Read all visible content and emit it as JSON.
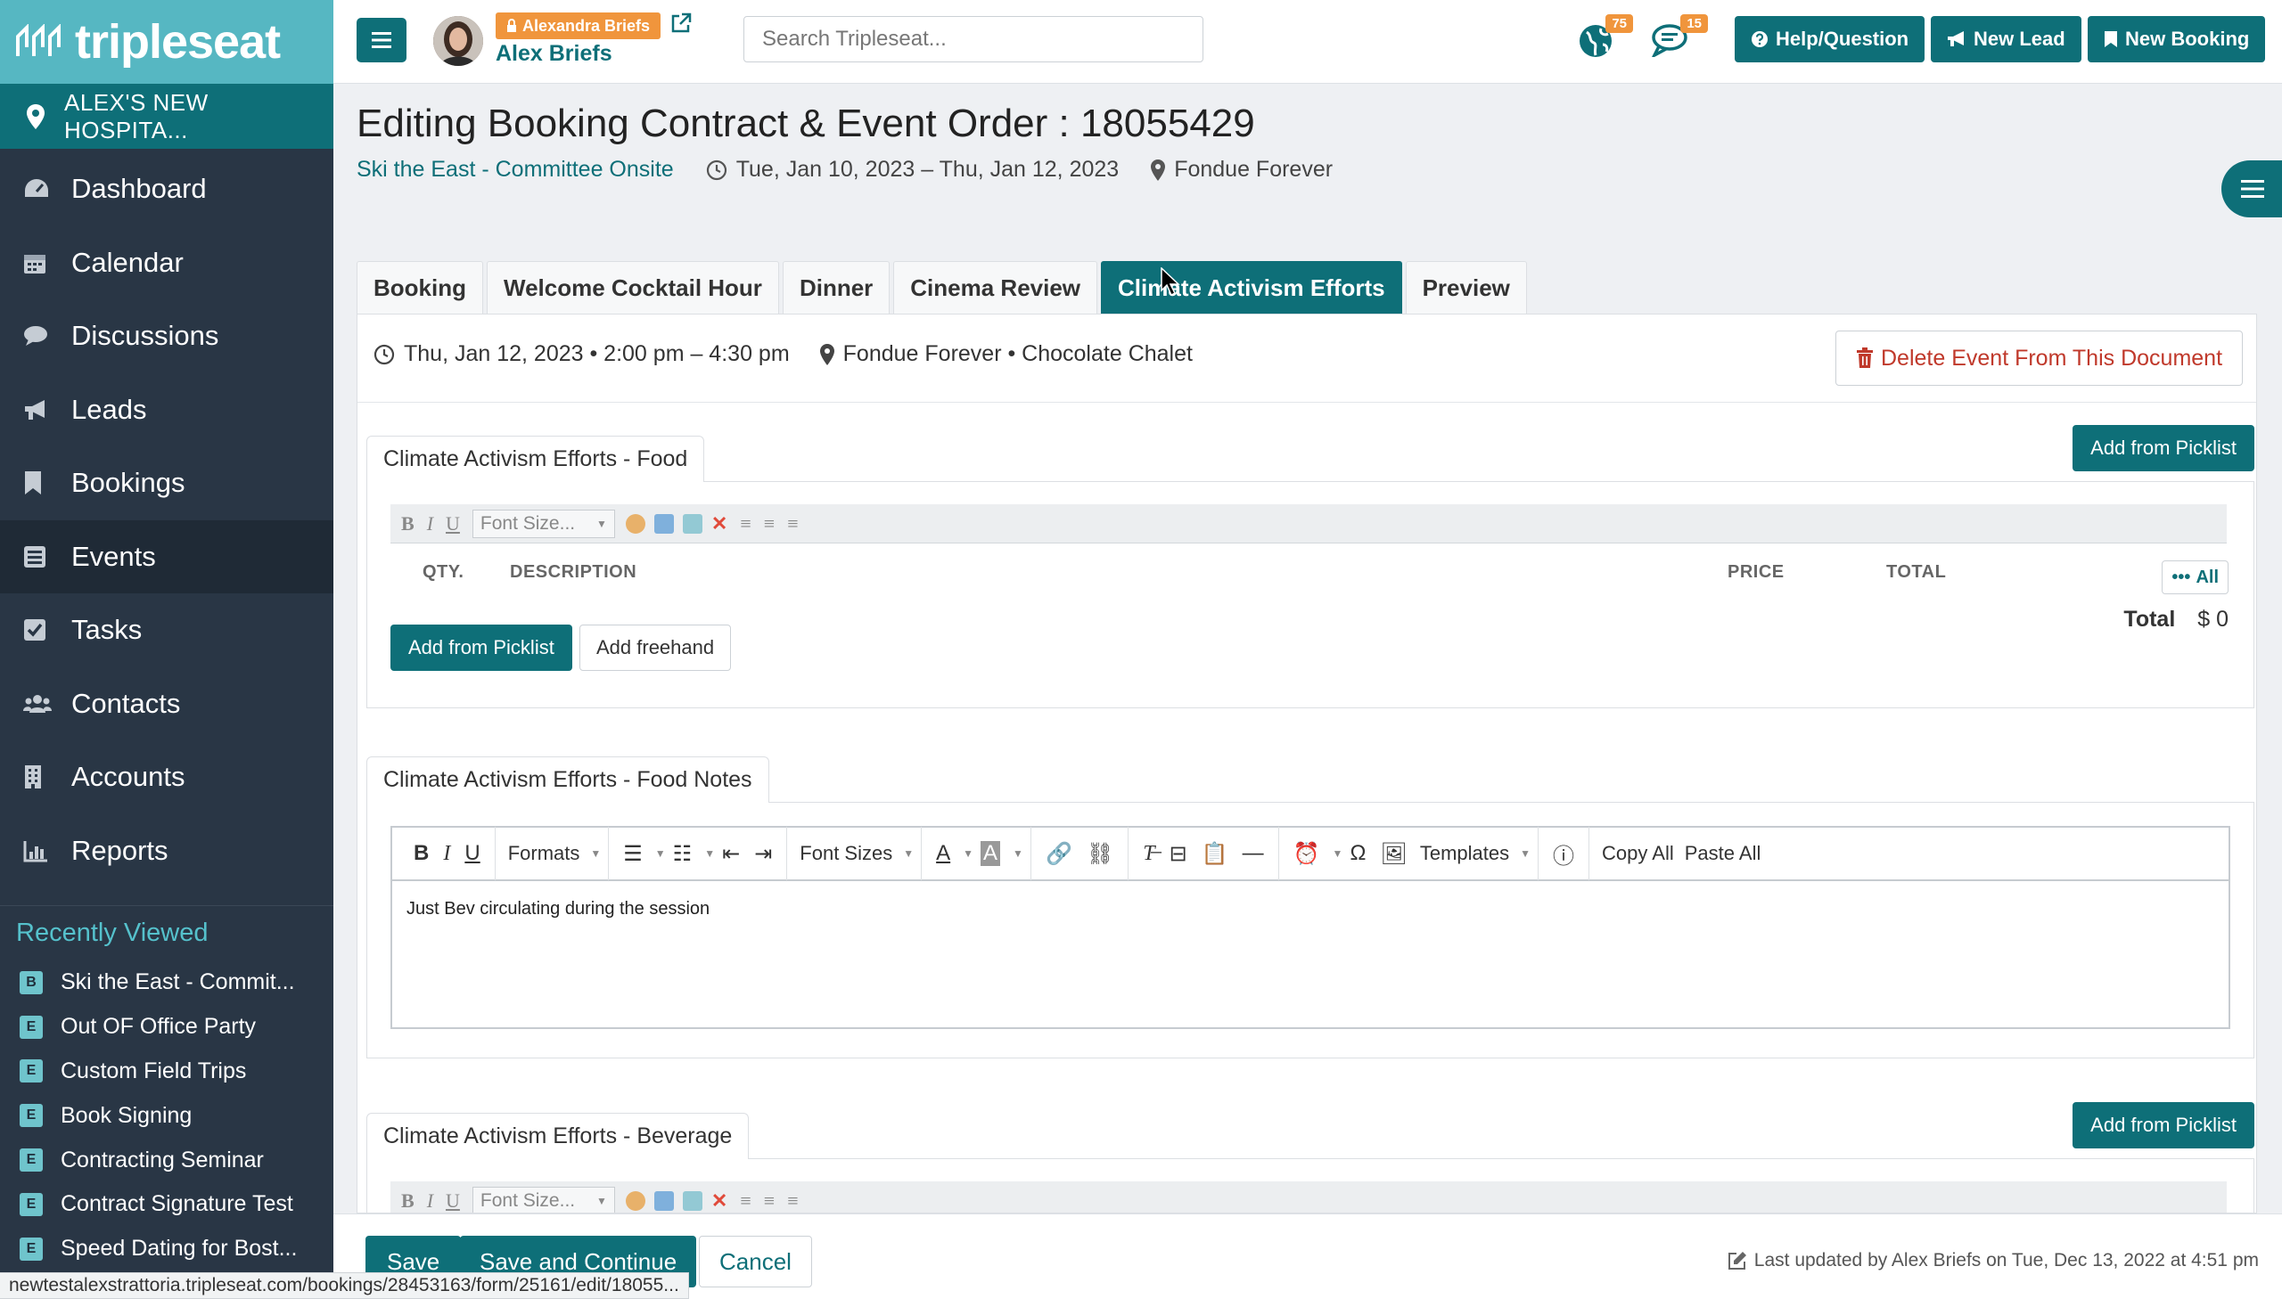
{
  "brand": {
    "name": "tripleseat",
    "accent": "#0e6f78",
    "logo_bg": "#56b7c2",
    "sidebar_bg": "#293645",
    "badge_color": "#f0953c"
  },
  "sidebar": {
    "venue": "ALEX'S NEW HOSPITA...",
    "nav": [
      {
        "label": "Dashboard",
        "icon": "dashboard-icon"
      },
      {
        "label": "Calendar",
        "icon": "calendar-icon"
      },
      {
        "label": "Discussions",
        "icon": "comment-icon"
      },
      {
        "label": "Leads",
        "icon": "megaphone-icon"
      },
      {
        "label": "Bookings",
        "icon": "bookmark-icon"
      },
      {
        "label": "Events",
        "icon": "list-icon"
      },
      {
        "label": "Tasks",
        "icon": "checkbox-icon"
      },
      {
        "label": "Contacts",
        "icon": "users-icon"
      },
      {
        "label": "Accounts",
        "icon": "building-icon"
      },
      {
        "label": "Reports",
        "icon": "bar-chart-icon"
      }
    ],
    "recent_title": "Recently Viewed",
    "recent": [
      {
        "badge": "B",
        "label": "Ski the East - Commit..."
      },
      {
        "badge": "E",
        "label": "Out OF Office Party"
      },
      {
        "badge": "E",
        "label": "Custom Field Trips"
      },
      {
        "badge": "E",
        "label": "Book Signing"
      },
      {
        "badge": "E",
        "label": "Contracting Seminar"
      },
      {
        "badge": "E",
        "label": "Contract Signature Test"
      },
      {
        "badge": "E",
        "label": "Speed Dating for Bost..."
      }
    ]
  },
  "topbar": {
    "impersonating": "Alexandra Briefs",
    "user_name": "Alex Briefs",
    "search_placeholder": "Search Tripleseat...",
    "notifications": {
      "globe": "75",
      "chat": "15"
    },
    "help_label": "Help/Question",
    "new_lead_label": "New Lead",
    "new_booking_label": "New Booking"
  },
  "header": {
    "title": "Editing Booking Contract & Event Order : 18055429",
    "booking_name": "Ski the East - Committee Onsite",
    "date_range": "Tue, Jan 10, 2023 – Thu, Jan 12, 2023",
    "location": "Fondue Forever"
  },
  "tabs": [
    {
      "label": "Booking",
      "active": false
    },
    {
      "label": "Welcome Cocktail Hour",
      "active": false
    },
    {
      "label": "Dinner",
      "active": false
    },
    {
      "label": "Cinema Review",
      "active": false
    },
    {
      "label": "Climate Activism Efforts",
      "active": true
    },
    {
      "label": "Preview",
      "active": false
    }
  ],
  "event": {
    "datetime": "Thu, Jan 12, 2023 • 2:00 pm – 4:30 pm",
    "location": "Fondue Forever • Chocolate Chalet",
    "delete_label": "Delete Event From This Document"
  },
  "sections": {
    "food": {
      "title": "Climate Activism Efforts - Food",
      "picklist_label": "Add from Picklist",
      "font_size_placeholder": "Font Size...",
      "columns": {
        "qty": "QTY.",
        "description": "DESCRIPTION",
        "price": "PRICE",
        "total": "TOTAL"
      },
      "all_label": "All",
      "total_label": "Total",
      "total_value": "$ 0",
      "add_picklist_label": "Add from Picklist",
      "add_freehand_label": "Add freehand"
    },
    "food_notes": {
      "title": "Climate Activism Efforts - Food Notes",
      "toolbar": {
        "formats": "Formats",
        "font_sizes": "Font Sizes",
        "templates": "Templates",
        "copy_all": "Copy All",
        "paste_all": "Paste All"
      },
      "body": "Just Bev circulating during the session"
    },
    "beverage": {
      "title": "Climate Activism Efforts - Beverage",
      "picklist_label": "Add from Picklist",
      "font_size_placeholder": "Font Size..."
    }
  },
  "footer": {
    "save_label": "Save",
    "save_continue_label": "Save and Continue",
    "cancel_label": "Cancel",
    "last_updated": "Last updated by Alex Briefs on Tue, Dec 13, 2022 at 4:51 pm"
  },
  "status_url": "newtestalexstrattoria.tripleseat.com/bookings/28453163/form/25161/edit/18055..."
}
